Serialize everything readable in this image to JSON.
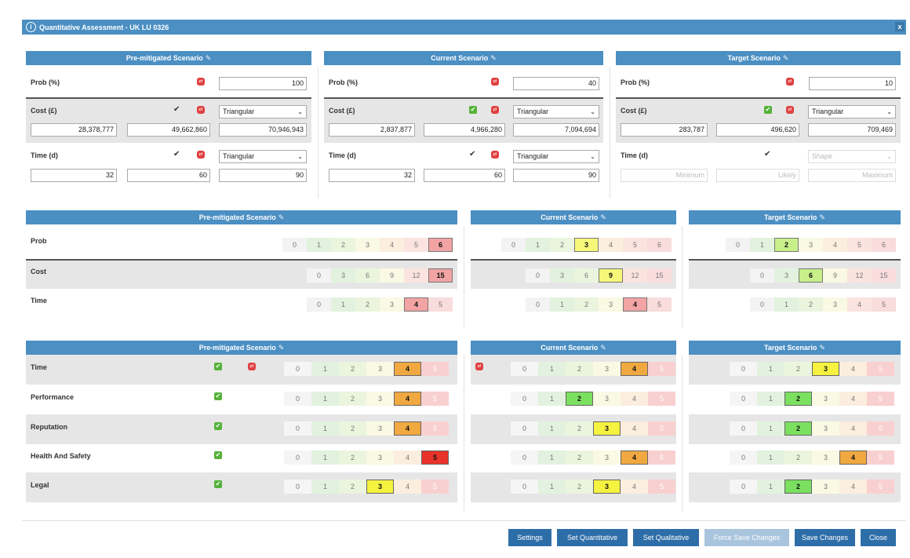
{
  "dialog": {
    "title": "Quantitative Assessment - UK LU 0326",
    "close_label": "x"
  },
  "top": {
    "columns": [
      {
        "header": "Pre-mitigated Scenario",
        "prob": "100",
        "cost_shape": "Triangular",
        "cost": [
          "28,378,777",
          "49,662,860",
          "70,946,943"
        ],
        "time_shape": "Triangular",
        "time": [
          "32",
          "60",
          "90"
        ]
      },
      {
        "header": "Current Scenario",
        "prob": "40",
        "cost_shape": "Triangular",
        "cost": [
          "2,837,877",
          "4,966,280",
          "7,094,694"
        ],
        "time_shape": "Triangular",
        "time": [
          "32",
          "60",
          "90"
        ]
      },
      {
        "header": "Target Scenario",
        "prob": "10",
        "cost_shape": "Triangular",
        "cost": [
          "283,787",
          "496,620",
          "709,469"
        ],
        "time_shape": "Shape",
        "time_placeholders": [
          "Minimum",
          "Likely",
          "Maximum"
        ]
      }
    ],
    "labels": {
      "prob": "Prob (%)",
      "cost": "Cost (£)",
      "time": "Time (d)"
    }
  },
  "middle": {
    "headers": [
      "Pre-mitigated Scenario",
      "Current Scenario",
      "Target Scenario"
    ],
    "rows": [
      {
        "label": "Prob",
        "scale": [
          "0",
          "1",
          "2",
          "3",
          "4",
          "5",
          "6"
        ],
        "selected": [
          6,
          3,
          2
        ]
      },
      {
        "label": "Cost",
        "scale": [
          "0",
          "3",
          "6",
          "9",
          "12",
          "15"
        ],
        "selected": [
          5,
          3,
          2
        ]
      },
      {
        "label": "Time",
        "scale": [
          "0",
          "1",
          "2",
          "3",
          "4",
          "5"
        ],
        "selected": [
          4,
          4,
          null
        ]
      }
    ]
  },
  "bottom": {
    "headers": [
      "Pre-mitigated Scenario",
      "Current Scenario",
      "Target Scenario"
    ],
    "scale": [
      "0",
      "1",
      "2",
      "3",
      "4",
      "5"
    ],
    "rows": [
      {
        "label": "Time",
        "selected": [
          4,
          4,
          3
        ]
      },
      {
        "label": "Performance",
        "selected": [
          4,
          2,
          2
        ]
      },
      {
        "label": "Reputation",
        "selected": [
          4,
          3,
          2
        ]
      },
      {
        "label": "Health And Safety",
        "selected": [
          5,
          4,
          4
        ]
      },
      {
        "label": "Legal",
        "selected": [
          3,
          3,
          2
        ]
      }
    ]
  },
  "footer": {
    "buttons": [
      "Settings",
      "Set Quantitative",
      "Set Qualitative",
      "Force Save Changes",
      "Save Changes",
      "Close"
    ]
  },
  "colors": {
    "header": "#4b8fc3",
    "button": "#2e6ea8",
    "scale_bg": [
      "#f3f3f3",
      "#e2f2de",
      "#ebf5de",
      "#f9f9e4",
      "#fbeede",
      "#fbe3e0",
      "#f9dcdc"
    ],
    "scale_sel_mid": [
      "#f3f3f3",
      "#e2f2de",
      "#c7ef8a",
      "#f7f77a",
      "#f3d6b0",
      "#f2a3a3",
      "#f2a3a3"
    ],
    "scale_sel_bot": [
      "#f3f3f3",
      "#e2f2de",
      "#7be060",
      "#f5f240",
      "#f0a840",
      "#e8322a"
    ]
  }
}
